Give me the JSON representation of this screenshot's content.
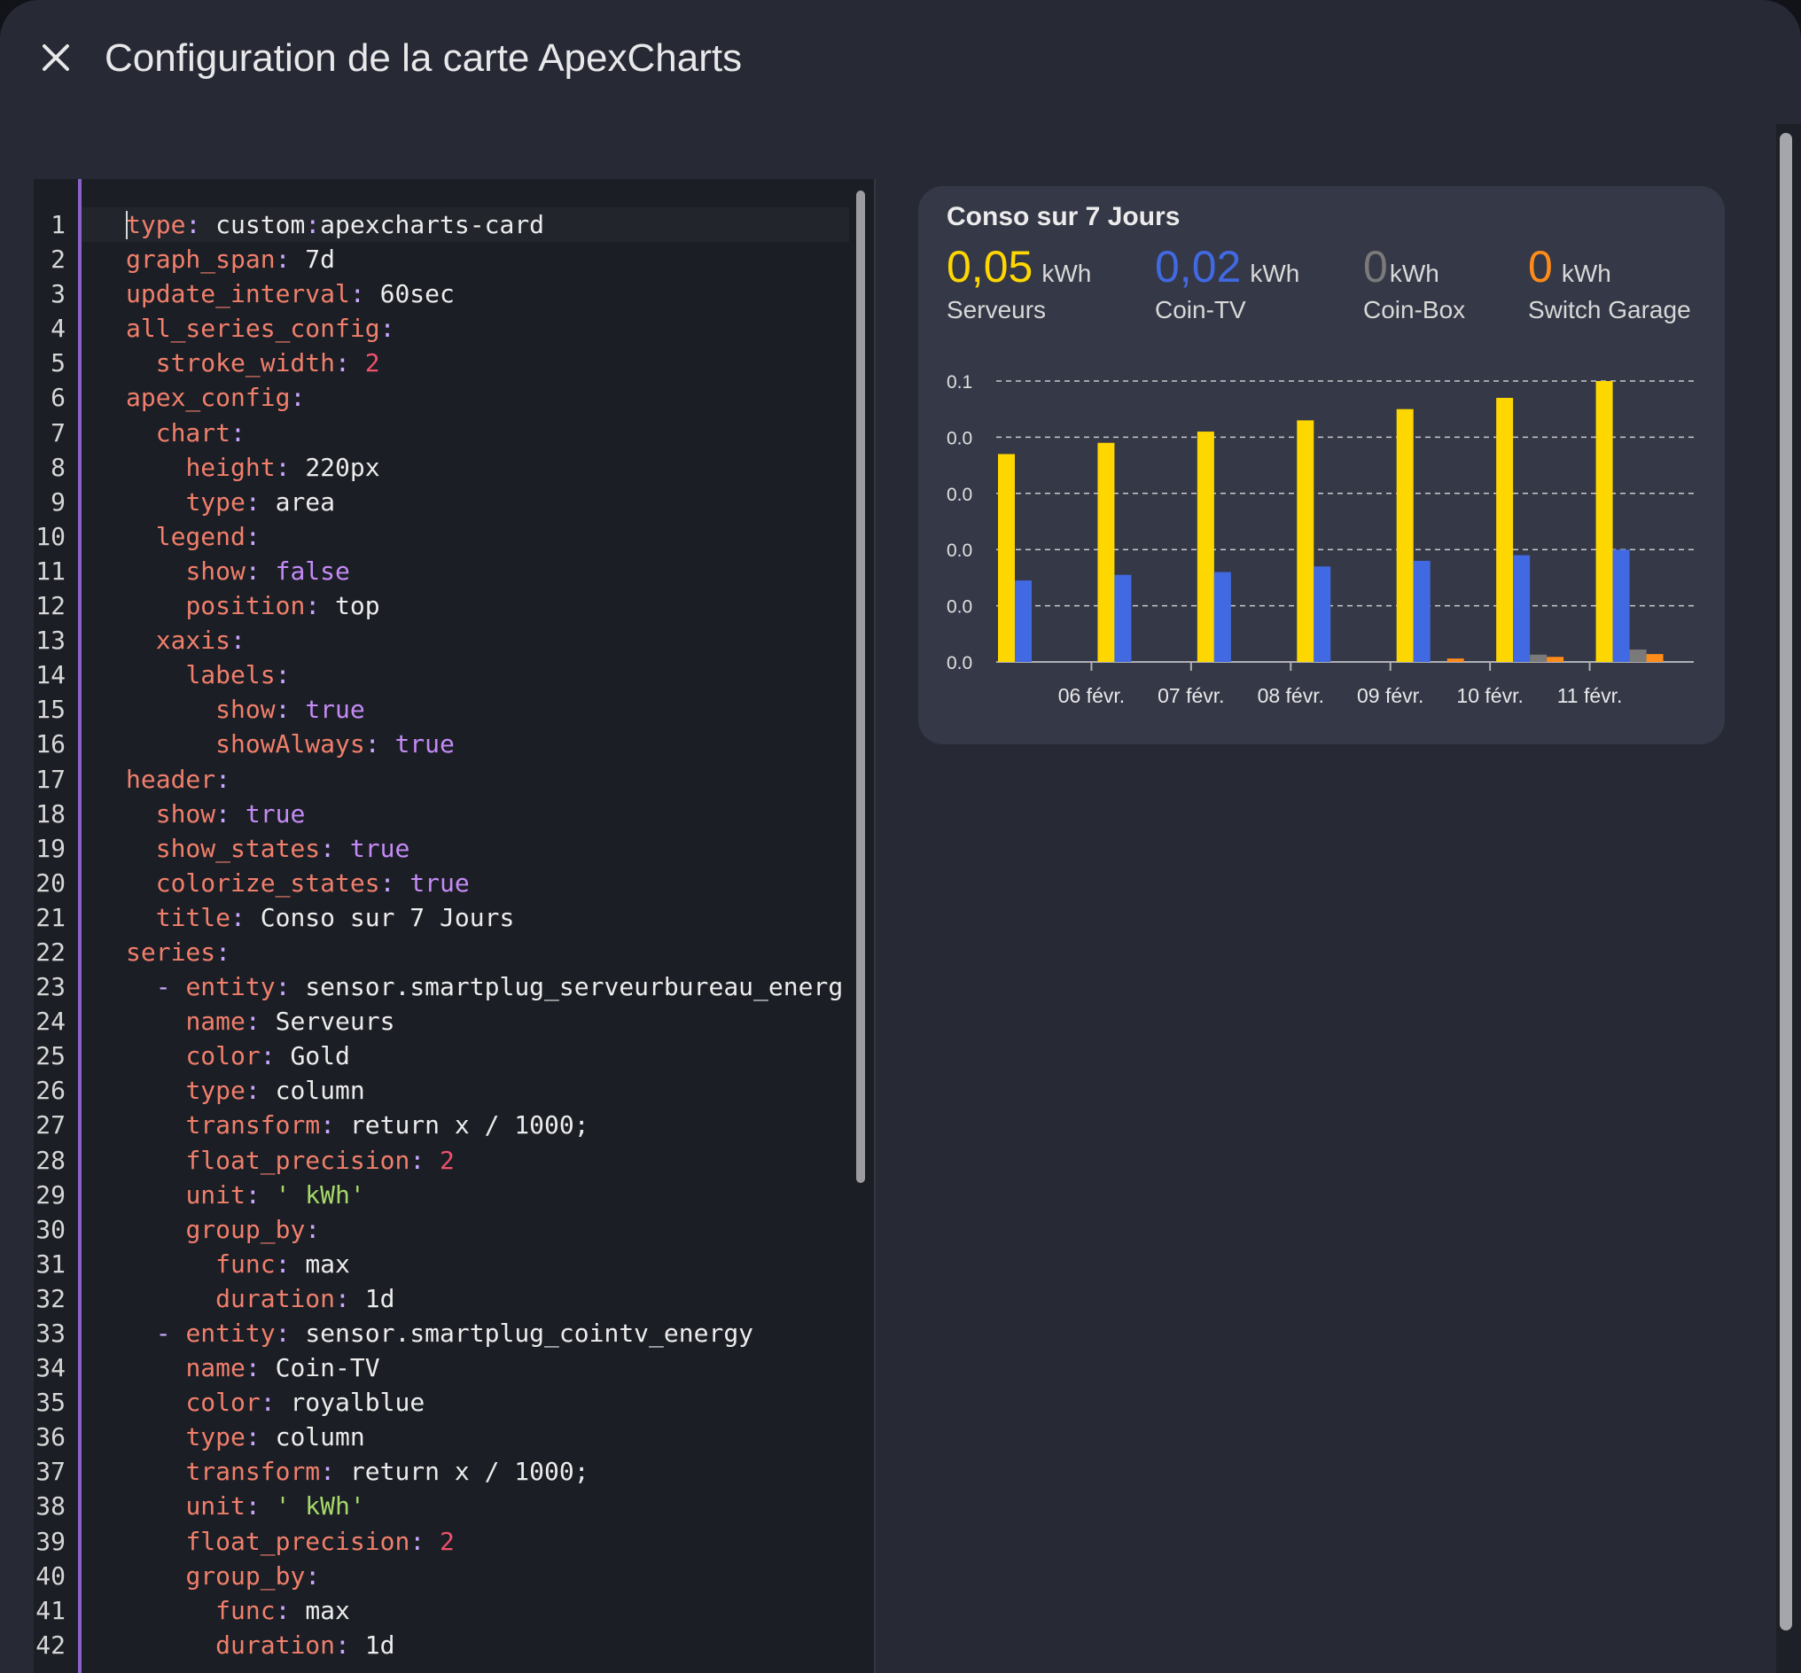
{
  "dialog": {
    "title": "Configuration de la carte ApexCharts"
  },
  "icons": {
    "close": "close-icon"
  },
  "editor": {
    "lines": [
      {
        "n": "1",
        "parts": [
          [
            "k",
            "type"
          ],
          [
            "p",
            ": "
          ],
          [
            "v",
            "custom"
          ],
          [
            "p",
            ":"
          ],
          [
            "v",
            "apexcharts-card"
          ]
        ]
      },
      {
        "n": "2",
        "parts": [
          [
            "k",
            "graph_span"
          ],
          [
            "p",
            ": "
          ],
          [
            "v",
            "7d"
          ]
        ]
      },
      {
        "n": "3",
        "parts": [
          [
            "k",
            "update_interval"
          ],
          [
            "p",
            ": "
          ],
          [
            "v",
            "60sec"
          ]
        ]
      },
      {
        "n": "4",
        "parts": [
          [
            "k",
            "all_series_config"
          ],
          [
            "p",
            ":"
          ]
        ]
      },
      {
        "n": "5",
        "parts": [
          [
            "v",
            "  "
          ],
          [
            "k",
            "stroke_width"
          ],
          [
            "p",
            ": "
          ],
          [
            "n",
            "2"
          ]
        ]
      },
      {
        "n": "6",
        "parts": [
          [
            "k",
            "apex_config"
          ],
          [
            "p",
            ":"
          ]
        ]
      },
      {
        "n": "7",
        "parts": [
          [
            "v",
            "  "
          ],
          [
            "k",
            "chart"
          ],
          [
            "p",
            ":"
          ]
        ]
      },
      {
        "n": "8",
        "parts": [
          [
            "v",
            "    "
          ],
          [
            "k",
            "height"
          ],
          [
            "p",
            ": "
          ],
          [
            "v",
            "220px"
          ]
        ]
      },
      {
        "n": "9",
        "parts": [
          [
            "v",
            "    "
          ],
          [
            "k",
            "type"
          ],
          [
            "p",
            ": "
          ],
          [
            "v",
            "area"
          ]
        ]
      },
      {
        "n": "10",
        "parts": [
          [
            "v",
            "  "
          ],
          [
            "k",
            "legend"
          ],
          [
            "p",
            ":"
          ]
        ]
      },
      {
        "n": "11",
        "parts": [
          [
            "v",
            "    "
          ],
          [
            "k",
            "show"
          ],
          [
            "p",
            ": "
          ],
          [
            "b",
            "false"
          ]
        ]
      },
      {
        "n": "12",
        "parts": [
          [
            "v",
            "    "
          ],
          [
            "k",
            "position"
          ],
          [
            "p",
            ": "
          ],
          [
            "v",
            "top"
          ]
        ]
      },
      {
        "n": "13",
        "parts": [
          [
            "v",
            "  "
          ],
          [
            "k",
            "xaxis"
          ],
          [
            "p",
            ":"
          ]
        ]
      },
      {
        "n": "14",
        "parts": [
          [
            "v",
            "    "
          ],
          [
            "k",
            "labels"
          ],
          [
            "p",
            ":"
          ]
        ]
      },
      {
        "n": "15",
        "parts": [
          [
            "v",
            "      "
          ],
          [
            "k",
            "show"
          ],
          [
            "p",
            ": "
          ],
          [
            "b",
            "true"
          ]
        ]
      },
      {
        "n": "16",
        "parts": [
          [
            "v",
            "      "
          ],
          [
            "k",
            "showAlways"
          ],
          [
            "p",
            ": "
          ],
          [
            "b",
            "true"
          ]
        ]
      },
      {
        "n": "17",
        "parts": [
          [
            "k",
            "header"
          ],
          [
            "p",
            ":"
          ]
        ]
      },
      {
        "n": "18",
        "parts": [
          [
            "v",
            "  "
          ],
          [
            "k",
            "show"
          ],
          [
            "p",
            ": "
          ],
          [
            "b",
            "true"
          ]
        ]
      },
      {
        "n": "19",
        "parts": [
          [
            "v",
            "  "
          ],
          [
            "k",
            "show_states"
          ],
          [
            "p",
            ": "
          ],
          [
            "b",
            "true"
          ]
        ]
      },
      {
        "n": "20",
        "parts": [
          [
            "v",
            "  "
          ],
          [
            "k",
            "colorize_states"
          ],
          [
            "p",
            ": "
          ],
          [
            "b",
            "true"
          ]
        ]
      },
      {
        "n": "21",
        "parts": [
          [
            "v",
            "  "
          ],
          [
            "k",
            "title"
          ],
          [
            "p",
            ": "
          ],
          [
            "v",
            "Conso sur 7 Jours"
          ]
        ]
      },
      {
        "n": "22",
        "parts": [
          [
            "k",
            "series"
          ],
          [
            "p",
            ":"
          ]
        ]
      },
      {
        "n": "23",
        "parts": [
          [
            "v",
            "  "
          ],
          [
            "p",
            "- "
          ],
          [
            "k",
            "entity"
          ],
          [
            "p",
            ": "
          ],
          [
            "v",
            "sensor.smartplug_serveurbureau_energ"
          ]
        ]
      },
      {
        "n": "24",
        "parts": [
          [
            "v",
            "    "
          ],
          [
            "k",
            "name"
          ],
          [
            "p",
            ": "
          ],
          [
            "v",
            "Serveurs"
          ]
        ]
      },
      {
        "n": "25",
        "parts": [
          [
            "v",
            "    "
          ],
          [
            "k",
            "color"
          ],
          [
            "p",
            ": "
          ],
          [
            "v",
            "Gold"
          ]
        ]
      },
      {
        "n": "26",
        "parts": [
          [
            "v",
            "    "
          ],
          [
            "k",
            "type"
          ],
          [
            "p",
            ": "
          ],
          [
            "v",
            "column"
          ]
        ]
      },
      {
        "n": "27",
        "parts": [
          [
            "v",
            "    "
          ],
          [
            "k",
            "transform"
          ],
          [
            "p",
            ": "
          ],
          [
            "v",
            "return x / 1000;"
          ]
        ]
      },
      {
        "n": "28",
        "parts": [
          [
            "v",
            "    "
          ],
          [
            "k",
            "float_precision"
          ],
          [
            "p",
            ": "
          ],
          [
            "n",
            "2"
          ]
        ]
      },
      {
        "n": "29",
        "parts": [
          [
            "v",
            "    "
          ],
          [
            "k",
            "unit"
          ],
          [
            "p",
            ": "
          ],
          [
            "s",
            "' kWh'"
          ]
        ]
      },
      {
        "n": "30",
        "parts": [
          [
            "v",
            "    "
          ],
          [
            "k",
            "group_by"
          ],
          [
            "p",
            ":"
          ]
        ]
      },
      {
        "n": "31",
        "parts": [
          [
            "v",
            "      "
          ],
          [
            "k",
            "func"
          ],
          [
            "p",
            ": "
          ],
          [
            "v",
            "max"
          ]
        ]
      },
      {
        "n": "32",
        "parts": [
          [
            "v",
            "      "
          ],
          [
            "k",
            "duration"
          ],
          [
            "p",
            ": "
          ],
          [
            "v",
            "1d"
          ]
        ]
      },
      {
        "n": "33",
        "parts": [
          [
            "v",
            "  "
          ],
          [
            "p",
            "- "
          ],
          [
            "k",
            "entity"
          ],
          [
            "p",
            ": "
          ],
          [
            "v",
            "sensor.smartplug_cointv_energy"
          ]
        ]
      },
      {
        "n": "34",
        "parts": [
          [
            "v",
            "    "
          ],
          [
            "k",
            "name"
          ],
          [
            "p",
            ": "
          ],
          [
            "v",
            "Coin-TV"
          ]
        ]
      },
      {
        "n": "35",
        "parts": [
          [
            "v",
            "    "
          ],
          [
            "k",
            "color"
          ],
          [
            "p",
            ": "
          ],
          [
            "v",
            "royalblue"
          ]
        ]
      },
      {
        "n": "36",
        "parts": [
          [
            "v",
            "    "
          ],
          [
            "k",
            "type"
          ],
          [
            "p",
            ": "
          ],
          [
            "v",
            "column"
          ]
        ]
      },
      {
        "n": "37",
        "parts": [
          [
            "v",
            "    "
          ],
          [
            "k",
            "transform"
          ],
          [
            "p",
            ": "
          ],
          [
            "v",
            "return x / 1000;"
          ]
        ]
      },
      {
        "n": "38",
        "parts": [
          [
            "v",
            "    "
          ],
          [
            "k",
            "unit"
          ],
          [
            "p",
            ": "
          ],
          [
            "s",
            "' kWh'"
          ]
        ]
      },
      {
        "n": "39",
        "parts": [
          [
            "v",
            "    "
          ],
          [
            "k",
            "float_precision"
          ],
          [
            "p",
            ": "
          ],
          [
            "n",
            "2"
          ]
        ]
      },
      {
        "n": "40",
        "parts": [
          [
            "v",
            "    "
          ],
          [
            "k",
            "group_by"
          ],
          [
            "p",
            ":"
          ]
        ]
      },
      {
        "n": "41",
        "parts": [
          [
            "v",
            "      "
          ],
          [
            "k",
            "func"
          ],
          [
            "p",
            ": "
          ],
          [
            "v",
            "max"
          ]
        ]
      },
      {
        "n": "42",
        "parts": [
          [
            "v",
            "      "
          ],
          [
            "k",
            "duration"
          ],
          [
            "p",
            ": "
          ],
          [
            "v",
            "1d"
          ]
        ]
      }
    ]
  },
  "card": {
    "title": "Conso sur 7 Jours",
    "states": [
      {
        "value": "0,05",
        "unit": "kWh",
        "name": "Serveurs",
        "color": "#FFD700"
      },
      {
        "value": "0,02",
        "unit": "kWh",
        "name": "Coin-TV",
        "color": "#4169E1"
      },
      {
        "value": "0",
        "unit": "kWh",
        "name": "Coin-Box",
        "color": "#7a7a7a"
      },
      {
        "value": "0",
        "unit": "kWh",
        "name": "Switch Garage",
        "color": "#FF8C1A"
      }
    ]
  },
  "chart_data": {
    "type": "bar",
    "categories": [
      "06 févr.",
      "07 févr.",
      "08 févr.",
      "09 févr.",
      "10 févr.",
      "11 févr."
    ],
    "y_tick_labels": [
      "0.1",
      "0.0",
      "0.0",
      "0.0",
      "0.0",
      "0.0"
    ],
    "ylim": [
      0,
      0.05
    ],
    "grid": true,
    "legend": "none",
    "series": [
      {
        "name": "Serveurs",
        "color": "#FFD700",
        "values": [
          0.037,
          0.039,
          0.041,
          0.043,
          0.045,
          0.047,
          0.05
        ]
      },
      {
        "name": "Coin-TV",
        "color": "#4169E1",
        "values": [
          0.0145,
          0.0155,
          0.016,
          0.017,
          0.018,
          0.019,
          0.02
        ]
      },
      {
        "name": "Coin-Box",
        "color": "#7a7a7a",
        "values": [
          0,
          0,
          0,
          0,
          0,
          0.0013,
          0.0022
        ]
      },
      {
        "name": "Switch Garage",
        "color": "#FF8C1A",
        "values": [
          0,
          0,
          0,
          0,
          0.0006,
          0.0009,
          0.0014
        ]
      }
    ]
  }
}
